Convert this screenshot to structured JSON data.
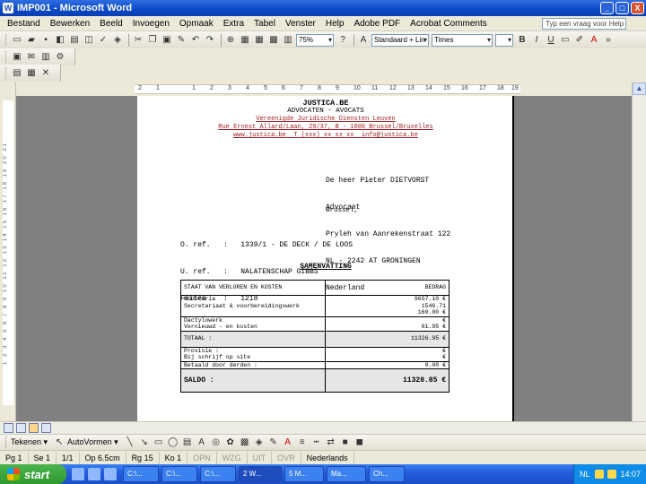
{
  "window": {
    "title": "IMP001 - Microsoft Word",
    "minimize_label": "_",
    "maximize_label": "□",
    "close_label": "X"
  },
  "menu": {
    "items": [
      "Bestand",
      "Bewerken",
      "Beeld",
      "Invoegen",
      "Opmaak",
      "Extra",
      "Tabel",
      "Venster",
      "Help",
      "Adobe PDF",
      "Acrobat Comments"
    ],
    "help_placeholder": "Typ een vraag voor Help"
  },
  "toolbar": {
    "zoom": "75%",
    "style": "Standaard + Lin",
    "font": "Times"
  },
  "ruler": {
    "ticks": [
      "2",
      "1",
      "1",
      "2",
      "3",
      "4",
      "5",
      "6",
      "7",
      "8",
      "9",
      "10",
      "11",
      "12",
      "13",
      "14",
      "15",
      "16",
      "17",
      "18",
      "19"
    ]
  },
  "vruler": {
    "ticks": "1 2 3 4 5 6 7 8 9 10 11 12 13 14 15 16 17 18 19 20 21"
  },
  "document": {
    "letterhead": {
      "name": "JUSTICA.BE",
      "subtitle": "ADVOCATEN - AVOCATS",
      "tagline": "Vereenigde Juridische Diensten Leuven",
      "address": "Rue Ernest Allard/Laan, 29/37, B - 1000 Brussel/Bruxelles",
      "contact": "www.justica.be  T (xxx) xx xx xx  info@justica.be"
    },
    "recipient_lines": [
      "De heer Pieter DIETVORST",
      "Advocaat",
      "Pryleh van Aanrekenstraat 122",
      "NL - 2242 AT GRONINGEN",
      "Nederland"
    ],
    "date_line": "Brussel,",
    "references": [
      "O. ref.   :   1339/1 - DE DECK / DE LOOS",
      "U. ref.   :   NALATENSCHAP GIBBS",
      "Feiten    :   1218"
    ],
    "section_title": "SAMENVATTING",
    "table": {
      "header": {
        "label": "STAAT VAN VERLOREN EN KOSTEN",
        "amount": "BEDRAG"
      },
      "rows": [
        {
          "label": "Honoraria",
          "amount": "9657.10 €"
        },
        {
          "label": "Secretariaat & voorbereidingswerk",
          "amount": "1546.71"
        },
        {
          "label": "",
          "amount": "160.00 €"
        },
        {
          "label": "Dactylowerk",
          "amount": "€"
        },
        {
          "label": "Vernieuwd - en kosten",
          "amount": "61.95 €"
        }
      ],
      "total": {
        "label": "TOTAAL :",
        "amount": "11326.95 €"
      },
      "rows2": [
        {
          "label": "Provisie :",
          "amount": "€"
        },
        {
          "label": "Bij schrijf op site",
          "amount": "€"
        },
        {
          "label": "Betaald door derden :",
          "amount": "0.00 €"
        }
      ],
      "saldo": {
        "label": "SALDO :",
        "amount": "11328.85 €"
      }
    }
  },
  "drawbar": {
    "draw_label": "Tekenen ▾",
    "autoshapes_label": "AutoVormen ▾"
  },
  "status": {
    "page": "Pg 1",
    "section": "Se 1",
    "pages": "1/1",
    "at": "Op 6.5cm",
    "line": "Rg 15",
    "col": "Ko 1",
    "rec": "OPN",
    "trk": "WZG",
    "ext": "UIT",
    "ovr": "OVR",
    "lang": "Nederlands"
  },
  "taskbar": {
    "start_label": "start",
    "tasks": [
      "C:\\...",
      "C:\\...",
      "C:\\...",
      "2 W...",
      "5 M...",
      "Ma...",
      "Ch..."
    ],
    "tray_lang": "NL",
    "clock": "14:07"
  }
}
